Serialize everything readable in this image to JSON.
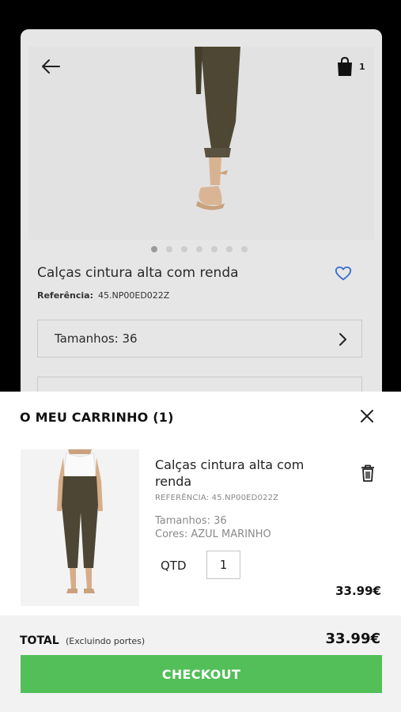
{
  "product": {
    "title": "Calças cintura alta com renda",
    "reference_label": "Referência:",
    "reference_value": "45.NP00ED022Z",
    "size_selector": "Tamanhos: 36",
    "second_selector": "",
    "bag_count": "1",
    "gallery_pages": 7,
    "gallery_active": 0
  },
  "cart": {
    "title": "O MEU CARRINHO (1)",
    "items": [
      {
        "name": "Calças cintura alta com renda",
        "reference": "REFERÊNCIA: 45.NP00ED022Z",
        "size": "Tamanhos: 36",
        "color": "Cores: AZUL MARINHO",
        "qty_label": "QTD",
        "qty": "1",
        "price": "33.99€"
      }
    ],
    "total_label": "TOTAL",
    "total_note": "(Excluindo portes)",
    "total_value": "33.99€",
    "checkout_label": "CHECKOUT"
  },
  "colors": {
    "checkout": "#52bf58",
    "favorite": "#3b6fd1"
  },
  "icons": [
    "arrow-left-icon",
    "shopping-bag-icon",
    "heart-icon",
    "chevron-right-icon",
    "close-icon",
    "trash-icon"
  ]
}
